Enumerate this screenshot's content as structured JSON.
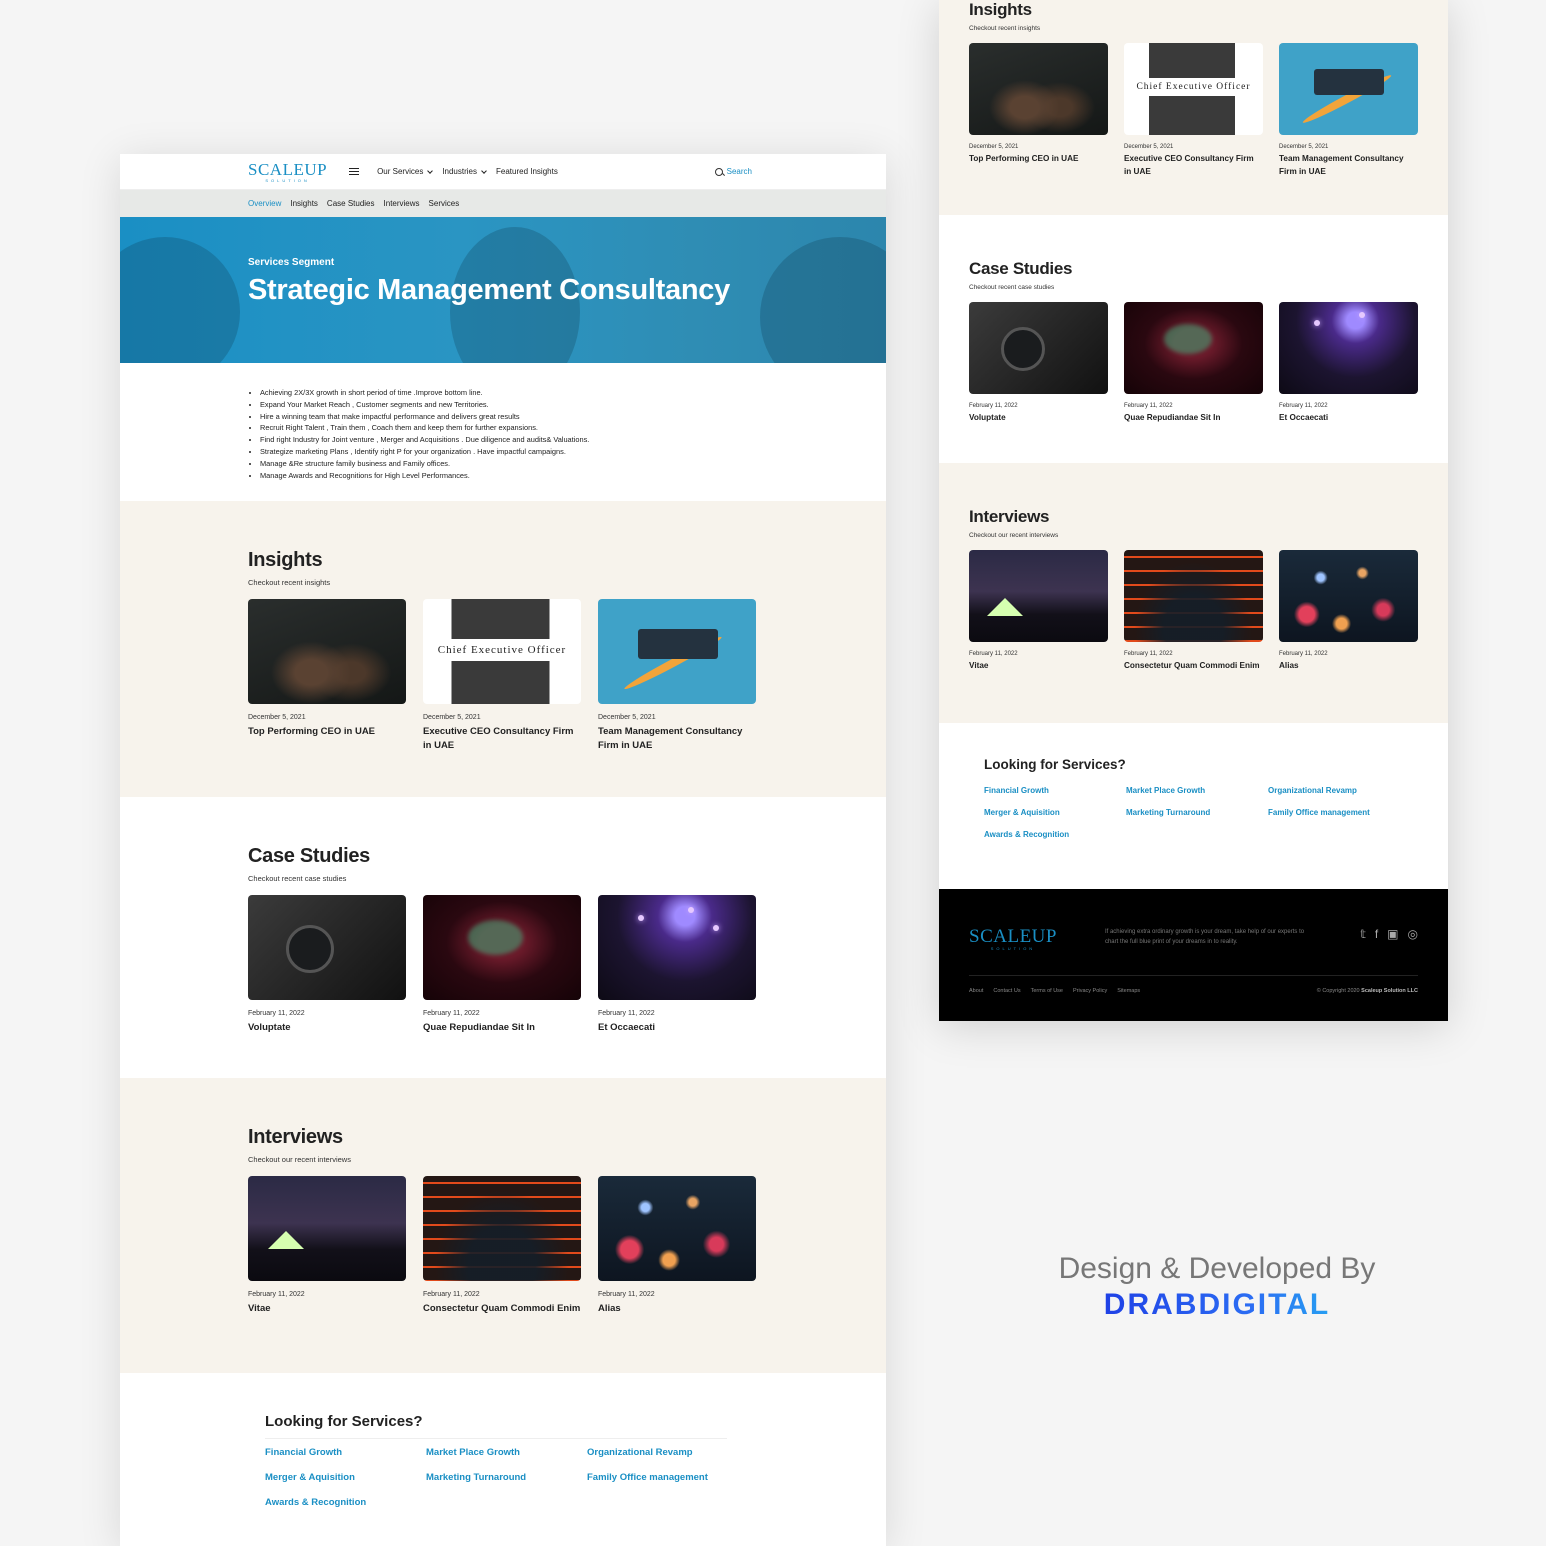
{
  "brand": {
    "logo": "SCALEUP",
    "logo_sub": "SOLUTION"
  },
  "topbar": {
    "nav": [
      "Our Services",
      "Industries",
      "Featured Insights"
    ],
    "search_label": "Search"
  },
  "subnav": {
    "items": [
      "Overview",
      "Insights",
      "Case Studies",
      "Interviews",
      "Services"
    ],
    "active": "Overview"
  },
  "hero": {
    "eyebrow": "Services Segment",
    "title": "Strategic Management Consultancy"
  },
  "bullets": [
    "Achieving 2X/3X growth in short period of time .Improve bottom line.",
    "Expand Your Market Reach , Customer segments and new Territories.",
    "Hire a winning team that make impactful performance and delivers great results",
    "Recruit Right Talent , Train them , Coach them and keep them for further expansions.",
    "Find right Industry for Joint venture , Merger and Acquisitions . Due diligence and audits& Valuations.",
    "Strategize marketing Plans , Identify right P for your organization . Have impactful campaigns.",
    "Manage &Re structure family business and Family offices.",
    "Manage Awards and Recognitions for High Level Performances."
  ],
  "insights": {
    "title": "Insights",
    "subtitle": "Checkout recent insights",
    "cards": [
      {
        "date": "December 5, 2021",
        "title": "Top Performing CEO in UAE"
      },
      {
        "date": "December 5, 2021",
        "title": "Executive CEO Consultancy Firm in UAE",
        "image_text": "Chief Executive Officer"
      },
      {
        "date": "December 5, 2021",
        "title": "Team Management Consultancy Firm in UAE"
      }
    ]
  },
  "case_studies": {
    "title": "Case Studies",
    "subtitle": "Checkout recent case studies",
    "cards": [
      {
        "date": "February 11, 2022",
        "title": "Voluptate"
      },
      {
        "date": "February 11, 2022",
        "title": "Quae Repudiandae Sit In"
      },
      {
        "date": "February 11, 2022",
        "title": "Et Occaecati"
      }
    ]
  },
  "interviews": {
    "title": "Interviews",
    "subtitle": "Checkout our recent interviews",
    "cards": [
      {
        "date": "February 11, 2022",
        "title": "Vitae"
      },
      {
        "date": "February 11, 2022",
        "title": "Consectetur Quam Commodi Enim"
      },
      {
        "date": "February 11, 2022",
        "title": "Alias"
      }
    ]
  },
  "services": {
    "title": "Looking for Services?",
    "links": [
      "Financial Growth",
      "Market Place Growth",
      "Organizational Revamp",
      "Merger & Aquisition",
      "Marketing Turnaround",
      "Family Office management",
      "Awards & Recognition"
    ]
  },
  "footer": {
    "tagline": "If achieving extra ordinary growth is your dream, take help of our experts to chart the full blue print of your dreams in to reality.",
    "links": [
      "About",
      "Contact Us",
      "Terms of Use",
      "Privacy Policy",
      "Sitemaps"
    ],
    "copyright_prefix": "© Copyright 2020",
    "copyright_owner": "Scaleup Solution LLC",
    "socials": [
      "twitter-icon",
      "facebook-icon",
      "linkedin-icon",
      "instagram-icon"
    ]
  },
  "credit": {
    "line": "Design & Developed By",
    "brand": "DRABDIGITAL"
  },
  "colors": {
    "accent": "#1a8fc4",
    "beige": "#f7f3ec",
    "subnav_bg": "#e7e9e7",
    "footer_bg": "#000000",
    "credit_brand": "#1a3bd8"
  }
}
